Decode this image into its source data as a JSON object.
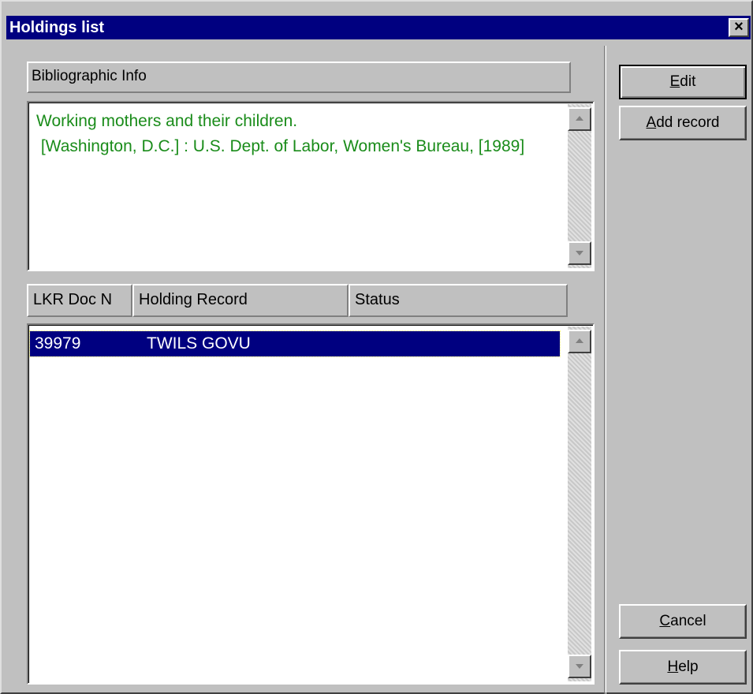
{
  "window": {
    "title": "Holdings list",
    "close_label": "×"
  },
  "bibliographic": {
    "label": "Bibliographic Info",
    "text": "Working mothers and their children.\n [Washington, D.C.] : U.S. Dept. of Labor, Women's Bureau, [1989]",
    "text_color": "#1a8c1a"
  },
  "columns": [
    "LKR Doc N",
    "Holding Record",
    "Status"
  ],
  "rows": [
    {
      "doc": "39979",
      "holding": "TWILS GOVU",
      "status": "",
      "selected": true
    }
  ],
  "buttons": {
    "edit_pre": "",
    "edit_u": "E",
    "edit_post": "dit",
    "add_pre": "",
    "add_u": "A",
    "add_post": "dd record",
    "cancel_pre": "",
    "cancel_u": "C",
    "cancel_post": "ancel",
    "help_pre": "",
    "help_u": "H",
    "help_post": "elp"
  },
  "icons": {
    "close": "close-icon",
    "scroll_up": "scroll-up-arrow-icon",
    "scroll_down": "scroll-down-arrow-icon"
  },
  "colors": {
    "titlebar": "#000080",
    "selection": "#000080",
    "dialog_bg": "#c0c0c0"
  }
}
